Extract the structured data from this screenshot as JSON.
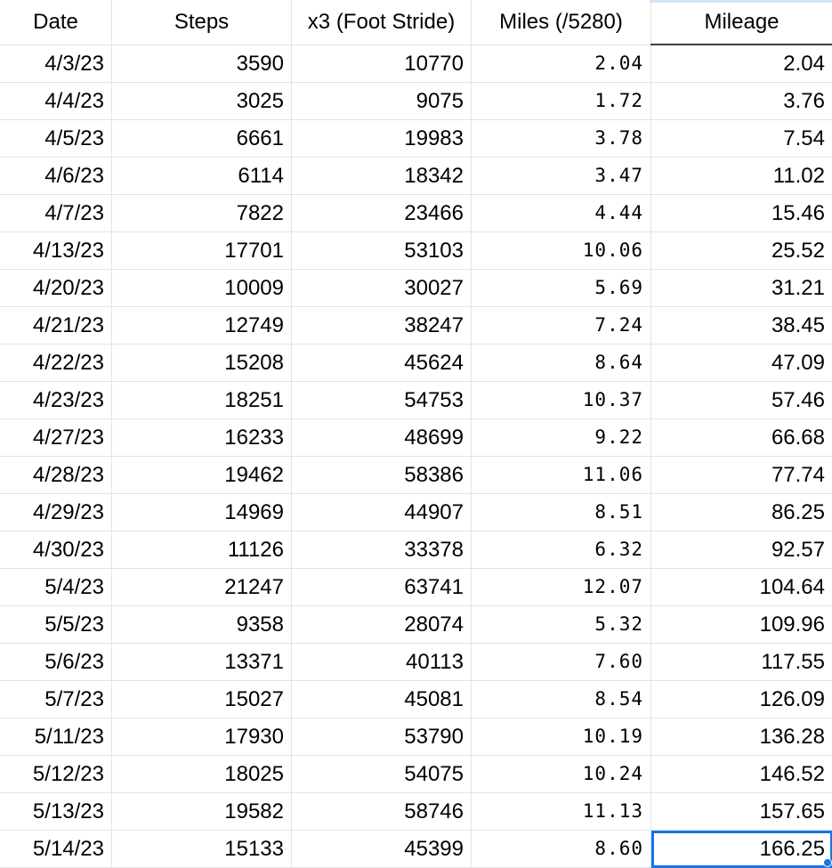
{
  "columns": {
    "date": "Date",
    "steps": "Steps",
    "stride": "x3 (Foot Stride)",
    "miles": "Miles (/5280)",
    "mileage": "Mileage"
  },
  "rows": [
    {
      "date": "4/3/23",
      "steps": "3590",
      "stride": "10770",
      "miles": "2.04",
      "mileage": "2.04"
    },
    {
      "date": "4/4/23",
      "steps": "3025",
      "stride": "9075",
      "miles": "1.72",
      "mileage": "3.76"
    },
    {
      "date": "4/5/23",
      "steps": "6661",
      "stride": "19983",
      "miles": "3.78",
      "mileage": "7.54"
    },
    {
      "date": "4/6/23",
      "steps": "6114",
      "stride": "18342",
      "miles": "3.47",
      "mileage": "11.02"
    },
    {
      "date": "4/7/23",
      "steps": "7822",
      "stride": "23466",
      "miles": "4.44",
      "mileage": "15.46"
    },
    {
      "date": "4/13/23",
      "steps": "17701",
      "stride": "53103",
      "miles": "10.06",
      "mileage": "25.52"
    },
    {
      "date": "4/20/23",
      "steps": "10009",
      "stride": "30027",
      "miles": "5.69",
      "mileage": "31.21"
    },
    {
      "date": "4/21/23",
      "steps": "12749",
      "stride": "38247",
      "miles": "7.24",
      "mileage": "38.45"
    },
    {
      "date": "4/22/23",
      "steps": "15208",
      "stride": "45624",
      "miles": "8.64",
      "mileage": "47.09"
    },
    {
      "date": "4/23/23",
      "steps": "18251",
      "stride": "54753",
      "miles": "10.37",
      "mileage": "57.46"
    },
    {
      "date": "4/27/23",
      "steps": "16233",
      "stride": "48699",
      "miles": "9.22",
      "mileage": "66.68"
    },
    {
      "date": "4/28/23",
      "steps": "19462",
      "stride": "58386",
      "miles": "11.06",
      "mileage": "77.74"
    },
    {
      "date": "4/29/23",
      "steps": "14969",
      "stride": "44907",
      "miles": "8.51",
      "mileage": "86.25"
    },
    {
      "date": "4/30/23",
      "steps": "11126",
      "stride": "33378",
      "miles": "6.32",
      "mileage": "92.57"
    },
    {
      "date": "5/4/23",
      "steps": "21247",
      "stride": "63741",
      "miles": "12.07",
      "mileage": "104.64"
    },
    {
      "date": "5/5/23",
      "steps": "9358",
      "stride": "28074",
      "miles": "5.32",
      "mileage": "109.96"
    },
    {
      "date": "5/6/23",
      "steps": "13371",
      "stride": "40113",
      "miles": "7.60",
      "mileage": "117.55"
    },
    {
      "date": "5/7/23",
      "steps": "15027",
      "stride": "45081",
      "miles": "8.54",
      "mileage": "126.09"
    },
    {
      "date": "5/11/23",
      "steps": "17930",
      "stride": "53790",
      "miles": "10.19",
      "mileage": "136.28"
    },
    {
      "date": "5/12/23",
      "steps": "18025",
      "stride": "54075",
      "miles": "10.24",
      "mileage": "146.52"
    },
    {
      "date": "5/13/23",
      "steps": "19582",
      "stride": "58746",
      "miles": "11.13",
      "mileage": "157.65"
    },
    {
      "date": "5/14/23",
      "steps": "15133",
      "stride": "45399",
      "miles": "8.60",
      "mileage": "166.25"
    }
  ],
  "selection": {
    "row": 21,
    "column": "mileage",
    "color": "#1a73e8"
  },
  "colors": {
    "gridline": "#e2e3e3",
    "selection": "#1a73e8",
    "text": "#000000"
  }
}
